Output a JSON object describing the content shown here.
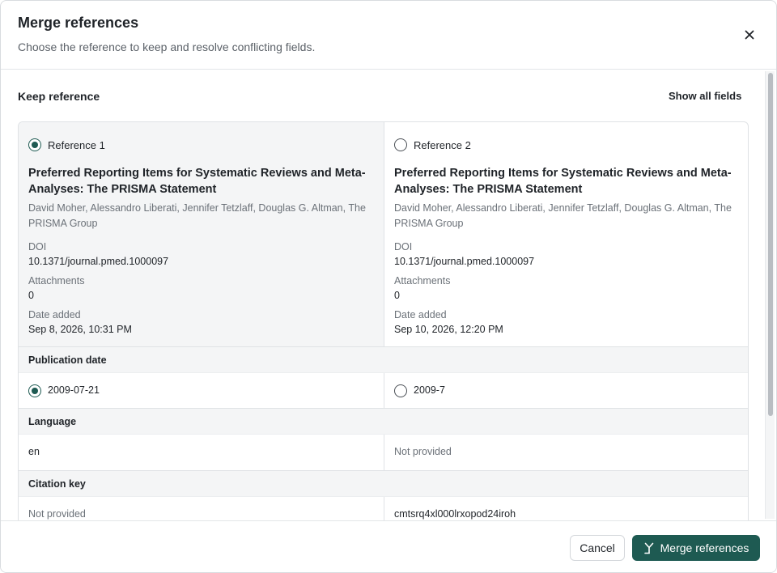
{
  "dialog": {
    "title": "Merge references",
    "subtitle": "Choose the reference to keep and resolve conflicting fields."
  },
  "keep": {
    "label": "Keep reference",
    "show_all": "Show all fields"
  },
  "references": [
    {
      "radio_label": "Reference 1",
      "selected": true,
      "title": "Preferred Reporting Items for Systematic Reviews and Meta-Analyses: The PRISMA Statement",
      "authors": "David Moher, Alessandro Liberati, Jennifer Tetzlaff, Douglas G. Altman, The PRISMA Group",
      "doi_label": "DOI",
      "doi": "10.1371/journal.pmed.1000097",
      "attachments_label": "Attachments",
      "attachments": "0",
      "date_added_label": "Date added",
      "date_added": "Sep 8, 2026, 10:31 PM"
    },
    {
      "radio_label": "Reference 2",
      "selected": false,
      "title": "Preferred Reporting Items for Systematic Reviews and Meta-Analyses: The PRISMA Statement",
      "authors": "David Moher, Alessandro Liberati, Jennifer Tetzlaff, Douglas G. Altman, The PRISMA Group",
      "doi_label": "DOI",
      "doi": "10.1371/journal.pmed.1000097",
      "attachments_label": "Attachments",
      "attachments": "0",
      "date_added_label": "Date added",
      "date_added": "Sep 10, 2026, 12:20 PM"
    }
  ],
  "fields": [
    {
      "name": "Publication date",
      "left": "2009-07-21",
      "right": "2009-7",
      "left_selected": true,
      "radios": true
    },
    {
      "name": "Language",
      "left": "en",
      "right": "Not provided",
      "radios": false
    },
    {
      "name": "Citation key",
      "left": "Not provided",
      "right": "cmtsrq4xl000lrxopod24iroh",
      "radios": false
    }
  ],
  "footer": {
    "cancel": "Cancel",
    "merge": "Merge references"
  },
  "colors": {
    "accent": "#1e5a52",
    "section_bg": "#f4f5f6",
    "border": "#dfe2e5",
    "muted_text": "#6b7178"
  },
  "icons": {
    "close": "close-icon",
    "merge": "merge-icon"
  }
}
